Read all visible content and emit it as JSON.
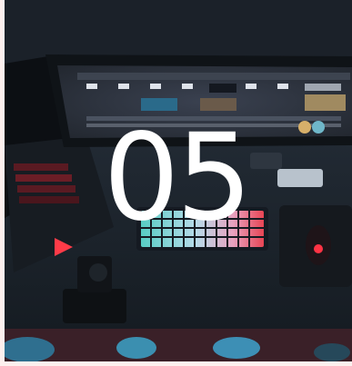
{
  "overlay": {
    "number": "05"
  },
  "colors": {
    "desk": "#1f2730",
    "monitor_bezel": "#0f1317",
    "screen_bg": "#2b3038",
    "keyboard_rgb_left": "#5fe0d6",
    "keyboard_rgb_right": "#ff4a5a",
    "laptop_key_glow": "#ff3b48",
    "text": "#ffffff"
  },
  "icons": [
    "monitor",
    "keyboard",
    "laptop",
    "camera",
    "mouse",
    "speaker",
    "sneakers"
  ]
}
